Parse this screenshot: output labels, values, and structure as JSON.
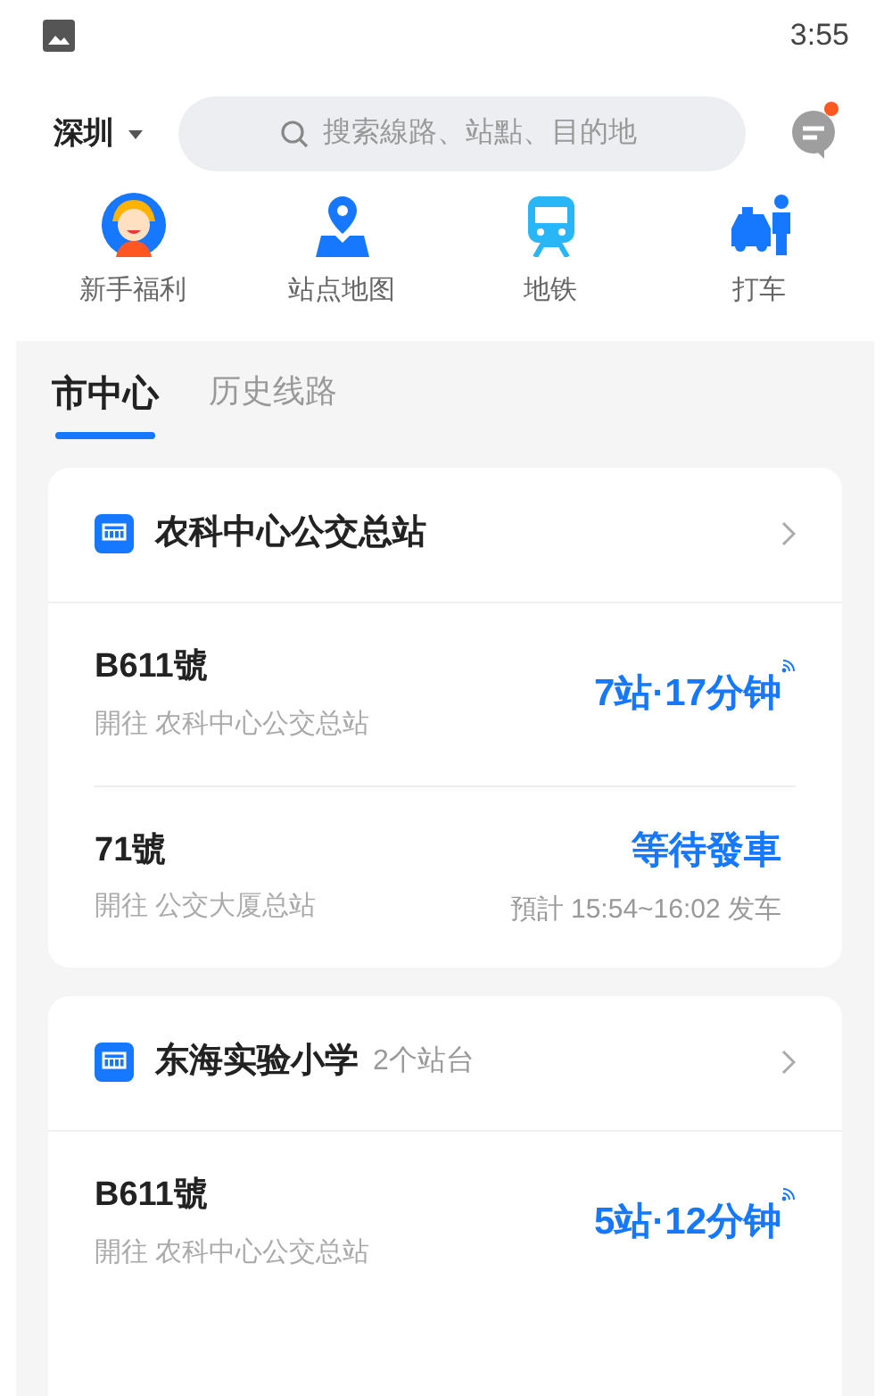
{
  "status_bar": {
    "time": "3:55"
  },
  "header": {
    "city": "深圳",
    "search": {
      "placeholder": "搜索線路、站點、目的地"
    },
    "messages": {
      "unread": true
    }
  },
  "shortcuts": [
    {
      "kind": "gift",
      "label": "新手福利"
    },
    {
      "kind": "map",
      "label": "站点地图"
    },
    {
      "kind": "subway",
      "label": "地铁"
    },
    {
      "kind": "taxi",
      "label": "打车"
    }
  ],
  "tabs": [
    {
      "label": "市中心",
      "selected": true
    },
    {
      "label": "历史线路",
      "selected": false
    }
  ],
  "stations": [
    {
      "name": "农科中心公交总站",
      "routes": [
        {
          "route": "B611號",
          "direction": "開往 农科中心公交总站",
          "status": "7站·17分钟",
          "live": true
        },
        {
          "route": "71號",
          "direction": "開往 公交大厦总站",
          "status": "等待發車",
          "schedule": "預計 15:54~16:02 发车",
          "live": false
        }
      ]
    },
    {
      "name": "东海实验小学",
      "platforms": "2个站台",
      "routes": [
        {
          "route": "B611號",
          "direction": "開往 农科中心公交总站",
          "status": "5站·12分钟",
          "live": true
        }
      ]
    }
  ]
}
